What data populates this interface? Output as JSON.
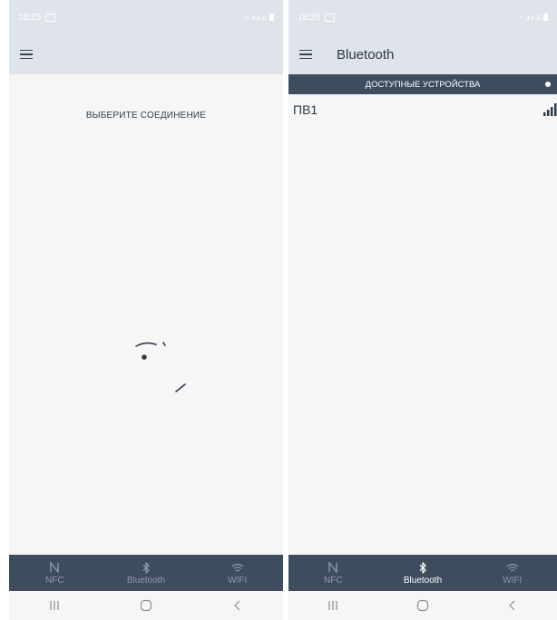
{
  "status_bar": {
    "time": "18:29",
    "right_text": "≈ งง.อ"
  },
  "screens": {
    "left": {
      "app_title": "",
      "prompt": "ВЫБЕРИТЕ СОЕДИНЕНИЕ"
    },
    "right": {
      "app_title": "Bluetooth",
      "section_header": "ДОСТУПНЫЕ УСТРОЙСТВА",
      "devices": [
        {
          "name": "ПВ1",
          "signal_icon": "signal-bars-icon"
        }
      ]
    }
  },
  "bottom_nav": {
    "items": [
      {
        "label": "NFC",
        "icon": "nfc-icon"
      },
      {
        "label": "Bluetooth",
        "icon": "bluetooth-icon"
      },
      {
        "label": "WIFI",
        "icon": "wifi-icon"
      }
    ],
    "left_active_index": -1,
    "right_active_index": 1
  },
  "system_nav": {
    "recents": "|||",
    "home": "home-icon",
    "back": "‹"
  },
  "colors": {
    "app_bar": "#dfe3ea",
    "dark_bar": "#3e4c5f",
    "background": "#f6f6f6",
    "text": "#2e3a4a",
    "inactive_nav": "#8f9aa8"
  }
}
